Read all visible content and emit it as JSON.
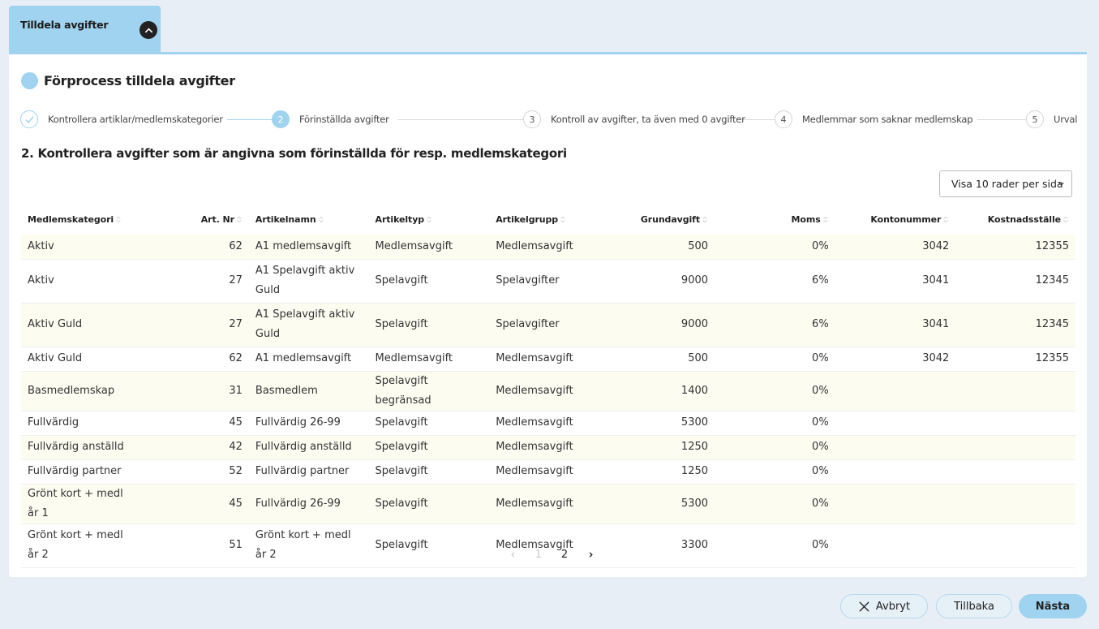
{
  "tab": {
    "title": "Tilldela avgifter"
  },
  "process": {
    "title": "Förprocess tilldela avgifter"
  },
  "steps": [
    {
      "number": "",
      "label": "Kontrollera artiklar/medlemskategorier",
      "state": "done"
    },
    {
      "number": "2",
      "label": "Förinställda avgifter",
      "state": "active"
    },
    {
      "number": "3",
      "label": "Kontroll av avgifter, ta även med 0 avgifter",
      "state": "pending"
    },
    {
      "number": "4",
      "label": "Medlemmar som saknar medlemskap",
      "state": "pending"
    },
    {
      "number": "5",
      "label": "Urval",
      "state": "pending"
    }
  ],
  "section": {
    "title": "2. Kontrollera avgifter som är angivna som förinställda för resp. medlemskategori"
  },
  "rows_per_page": {
    "label": "Visa 10 rader per sida"
  },
  "table": {
    "columns": [
      "Medlemskategori",
      "Art. Nr",
      "Artikelnamn",
      "Artikeltyp",
      "Artikelgrupp",
      "Grundavgift",
      "Moms",
      "Kontonummer",
      "Kostnadsställe"
    ],
    "rows": [
      [
        "Aktiv",
        "62",
        "A1 medlemsavgift",
        "Medlemsavgift",
        "Medlemsavgift",
        "500",
        "0%",
        "3042",
        "12355"
      ],
      [
        "Aktiv",
        "27",
        "A1 Spelavgift aktiv Guld",
        "Spelavgift",
        "Spelavgifter",
        "9000",
        "6%",
        "3041",
        "12345"
      ],
      [
        "Aktiv Guld",
        "27",
        "A1 Spelavgift aktiv Guld",
        "Spelavgift",
        "Spelavgifter",
        "9000",
        "6%",
        "3041",
        "12345"
      ],
      [
        "Aktiv Guld",
        "62",
        "A1 medlemsavgift",
        "Medlemsavgift",
        "Medlemsavgift",
        "500",
        "0%",
        "3042",
        "12355"
      ],
      [
        "Basmedlemskap",
        "31",
        "Basmedlem",
        "Spelavgift begränsad",
        "Medlemsavgift",
        "1400",
        "0%",
        "",
        ""
      ],
      [
        "Fullvärdig",
        "45",
        "Fullvärdig 26-99",
        "Spelavgift",
        "Medlemsavgift",
        "5300",
        "0%",
        "",
        ""
      ],
      [
        "Fullvärdig anställd",
        "42",
        "Fullvärdig anställd",
        "Spelavgift",
        "Medlemsavgift",
        "1250",
        "0%",
        "",
        ""
      ],
      [
        "Fullvärdig partner",
        "52",
        "Fullvärdig partner",
        "Spelavgift",
        "Medlemsavgift",
        "1250",
        "0%",
        "",
        ""
      ],
      [
        "Grönt kort + medl år 1",
        "45",
        "Fullvärdig 26-99",
        "Spelavgift",
        "Medlemsavgift",
        "5300",
        "0%",
        "",
        ""
      ],
      [
        "Grönt kort + medl år 2",
        "51",
        "Grönt kort + medl år 2",
        "Spelavgift",
        "Medlemsavgift",
        "3300",
        "0%",
        "",
        ""
      ]
    ]
  },
  "pagination": {
    "pages": [
      "1",
      "2"
    ],
    "current": "2"
  },
  "buttons": {
    "cancel": "Avbryt",
    "back": "Tillbaka",
    "next": "Nästa"
  }
}
